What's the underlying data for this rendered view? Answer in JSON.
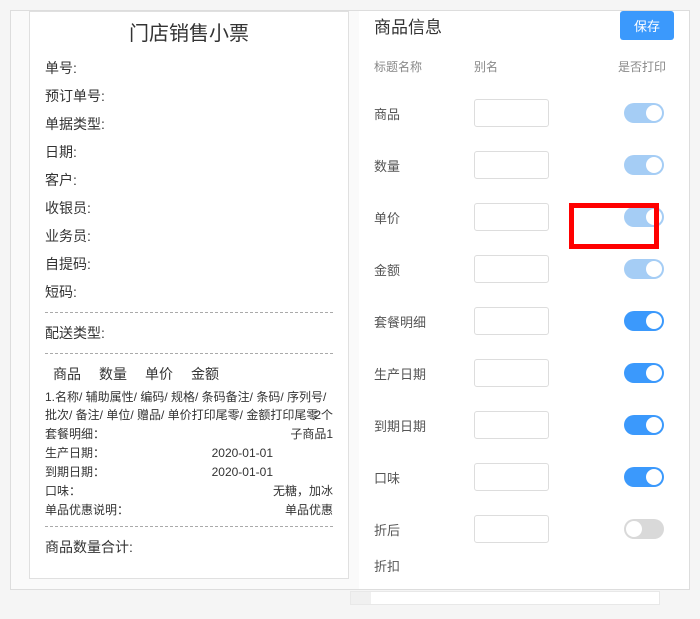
{
  "receipt": {
    "title": "门店销售小票",
    "fields": {
      "order_no": "单号:",
      "reserve_no": "预订单号:",
      "doc_type": "单据类型:",
      "date": "日期:",
      "customer": "客户:",
      "cashier": "收银员:",
      "salesman": "业务员:",
      "pickup_code": "自提码:",
      "short_code": "短码:",
      "delivery_type": "配送类型:"
    },
    "item_header": {
      "c1": "商品",
      "c2": "数量",
      "c3": "单价",
      "c4": "金额"
    },
    "item_line1": "1.名称/ 辅助属性/ 编码/ 规格/ 条码备注/ 条码/ 序列号/ 批次/ 备注/ 单位/ 赠品/ 单价打印尾零/ 金额打印尾零",
    "item_qty": "2个",
    "combo_label": "套餐明细：",
    "combo_value": "子商品1",
    "prod_date_label": "生产日期：",
    "prod_date_value": "2020-01-01",
    "exp_date_label": "到期日期：",
    "exp_date_value": "2020-01-01",
    "flavor_label": "口味：",
    "flavor_value": "无糖，加冰",
    "disc_note_label": "单品优惠说明：",
    "disc_note_value": "单品优惠",
    "qty_total_label": "商品数量合计:"
  },
  "config": {
    "title": "商品信息",
    "save_label": "保存",
    "cols": {
      "title": "标题名称",
      "alias": "别名",
      "print": "是否打印"
    },
    "rows": {
      "product": "商品",
      "qty": "数量",
      "price": "单价",
      "amount": "金额",
      "combo": "套餐明细",
      "prod_date": "生产日期",
      "exp_date": "到期日期",
      "flavor": "口味",
      "after_disc": "折后",
      "last": "折扣"
    }
  }
}
